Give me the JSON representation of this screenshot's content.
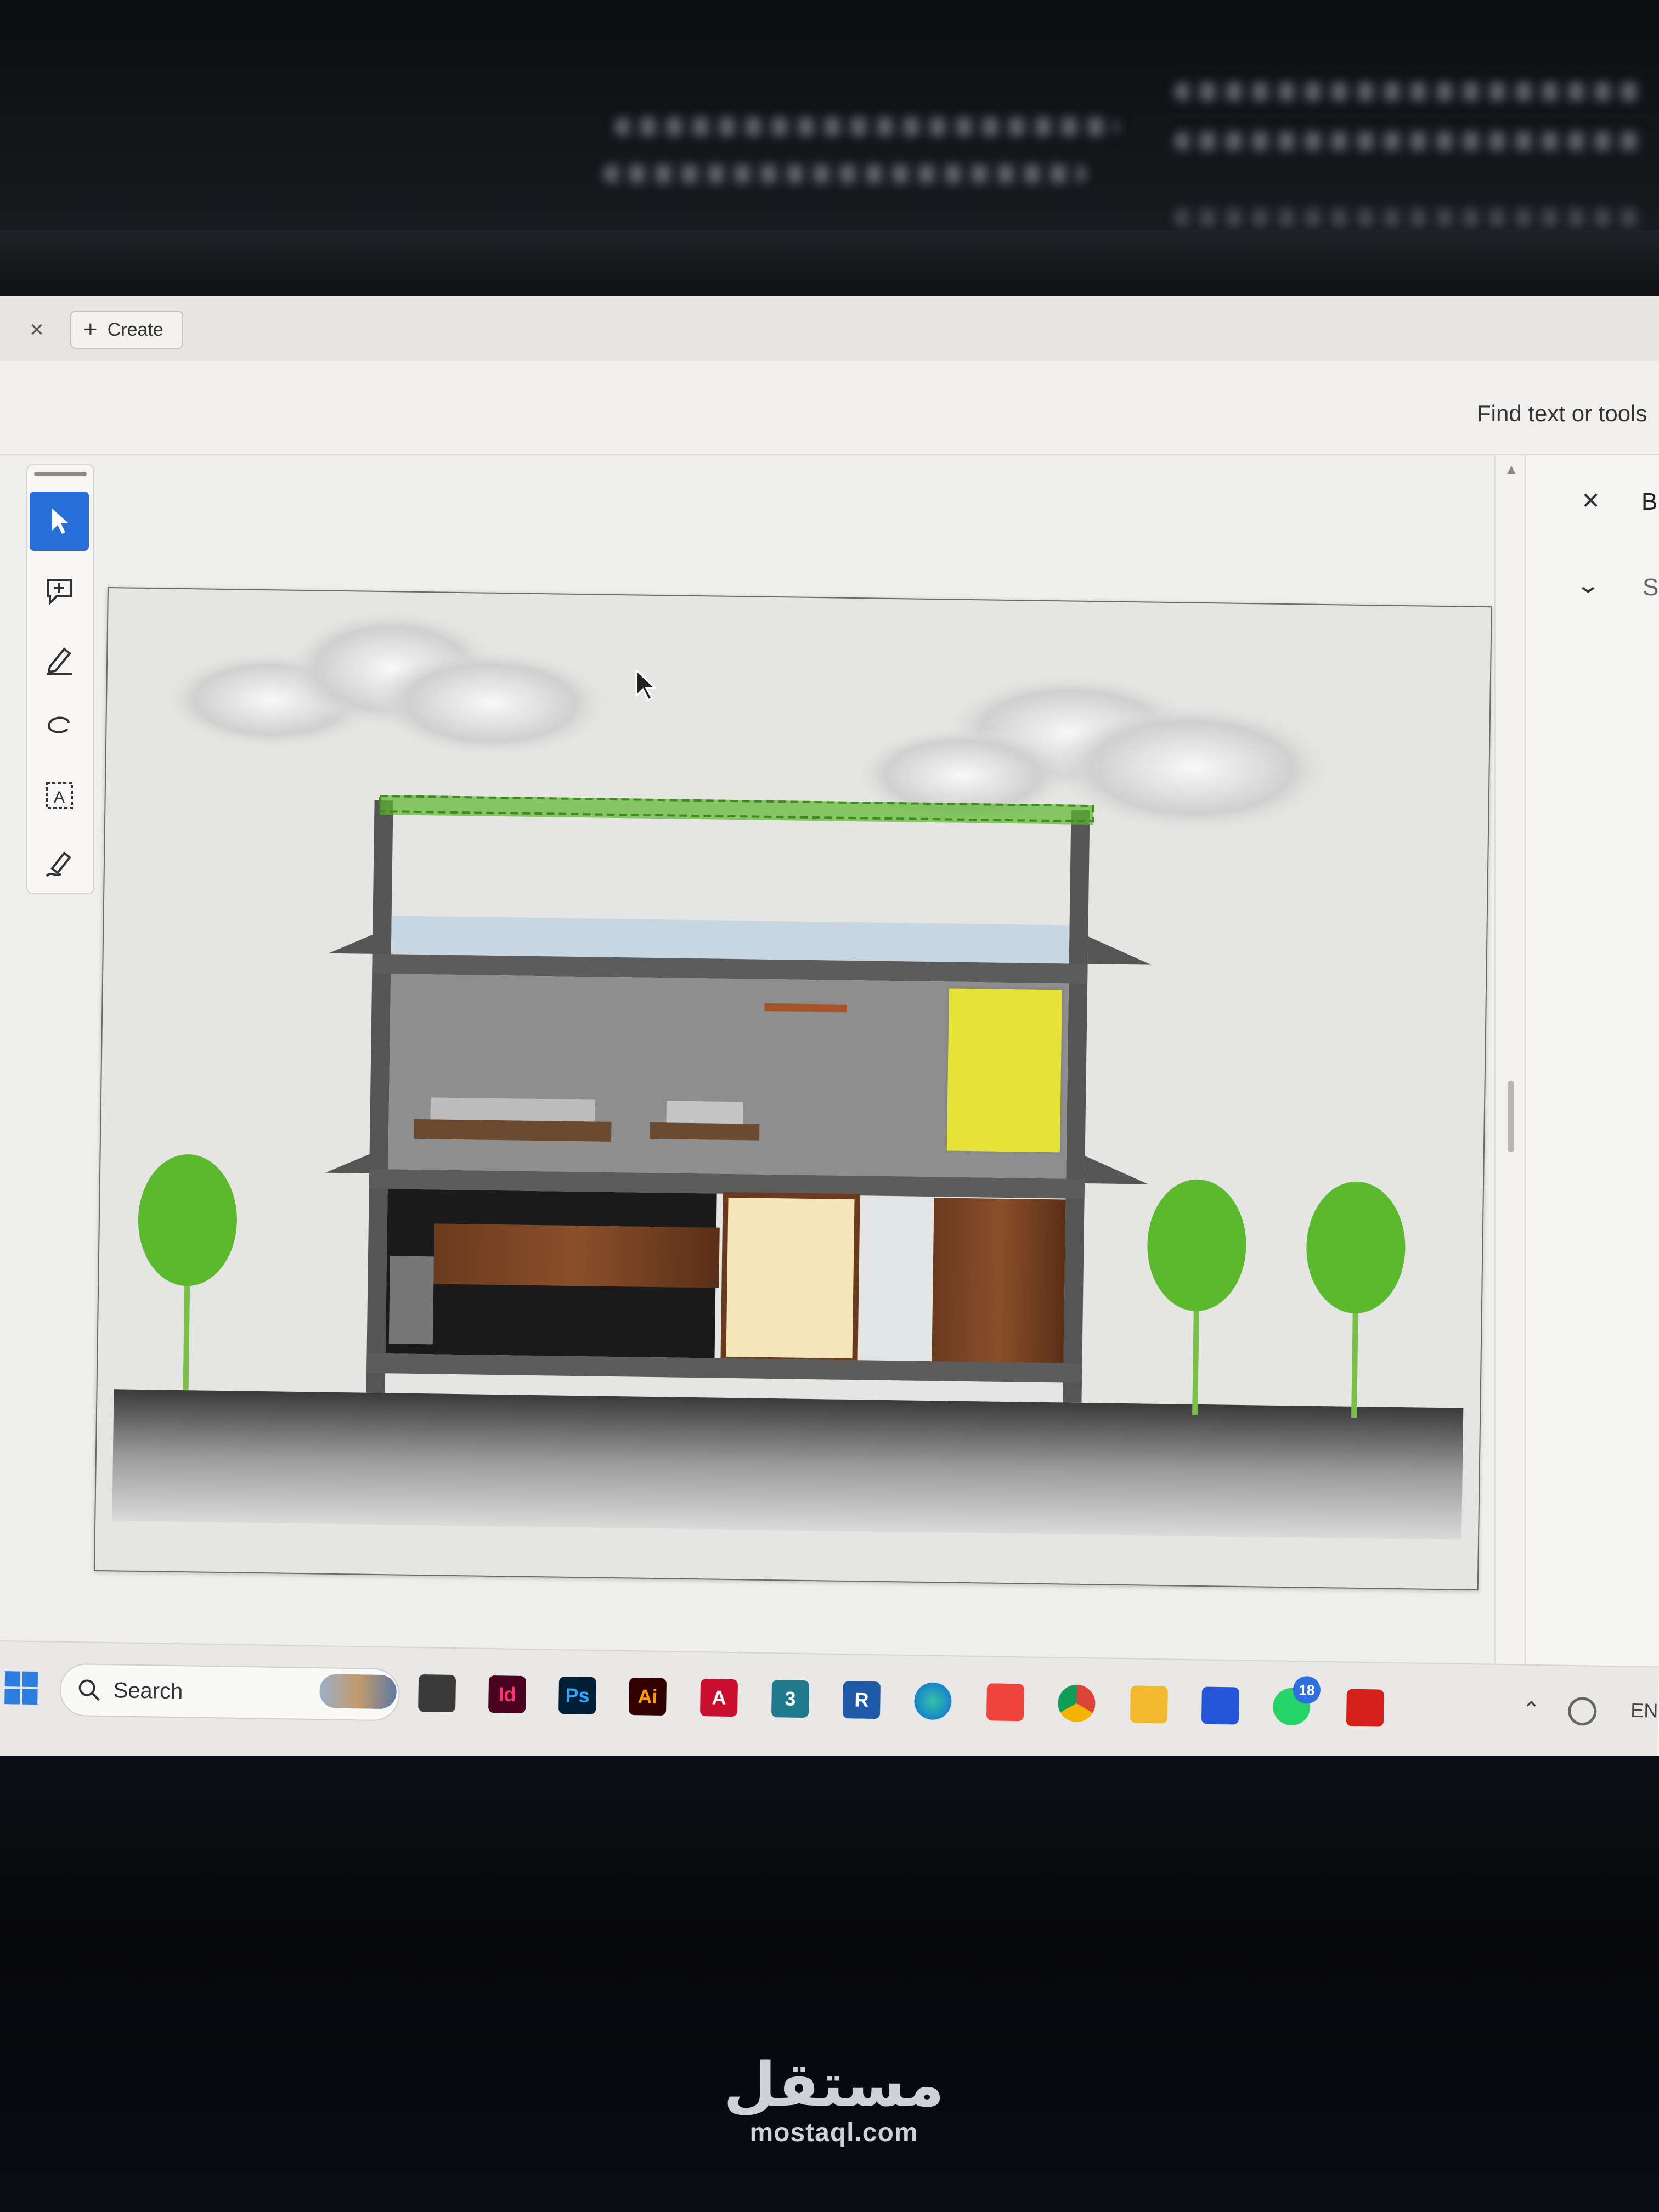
{
  "tabbar": {
    "create_label": "Create"
  },
  "toolbar": {
    "find_placeholder": "Find text or tools"
  },
  "left_tools": [
    {
      "name": "select-tool",
      "icon": "arrow-pointer-icon"
    },
    {
      "name": "add-comment-tool",
      "icon": "comment-plus-icon"
    },
    {
      "name": "highlight-tool",
      "icon": "pen-icon"
    },
    {
      "name": "draw-tool",
      "icon": "lasso-icon"
    },
    {
      "name": "text-tool",
      "icon": "text-box-icon"
    },
    {
      "name": "sign-tool",
      "icon": "signature-pen-icon"
    }
  ],
  "right_panel": {
    "heading_initial": "B",
    "sub_initial": "S"
  },
  "taskbar": {
    "search_label": "Search",
    "apps": [
      {
        "name": "file-explorer-app",
        "label": ""
      },
      {
        "name": "indesign-app",
        "label": "Id"
      },
      {
        "name": "photoshop-app",
        "label": "Ps"
      },
      {
        "name": "illustrator-app",
        "label": "Ai"
      },
      {
        "name": "autocad-app",
        "label": "A"
      },
      {
        "name": "3dsmax-app",
        "label": "3"
      },
      {
        "name": "revit-app",
        "label": "R"
      },
      {
        "name": "edge-app",
        "label": ""
      },
      {
        "name": "anydesk-app",
        "label": ""
      },
      {
        "name": "chrome-app",
        "label": ""
      },
      {
        "name": "folder-app",
        "label": ""
      },
      {
        "name": "mail-app",
        "label": ""
      },
      {
        "name": "whatsapp-app",
        "label": ""
      },
      {
        "name": "acrobat-app",
        "label": ""
      }
    ],
    "whatsapp_badge": "18",
    "language": "EN"
  },
  "watermark": {
    "arabic": "مستقل",
    "latin": "mostaql.com"
  },
  "colors": {
    "accent": "#2a6fd8",
    "green_roof": "#5cb82c",
    "yellow_panel": "#e6e23a"
  }
}
